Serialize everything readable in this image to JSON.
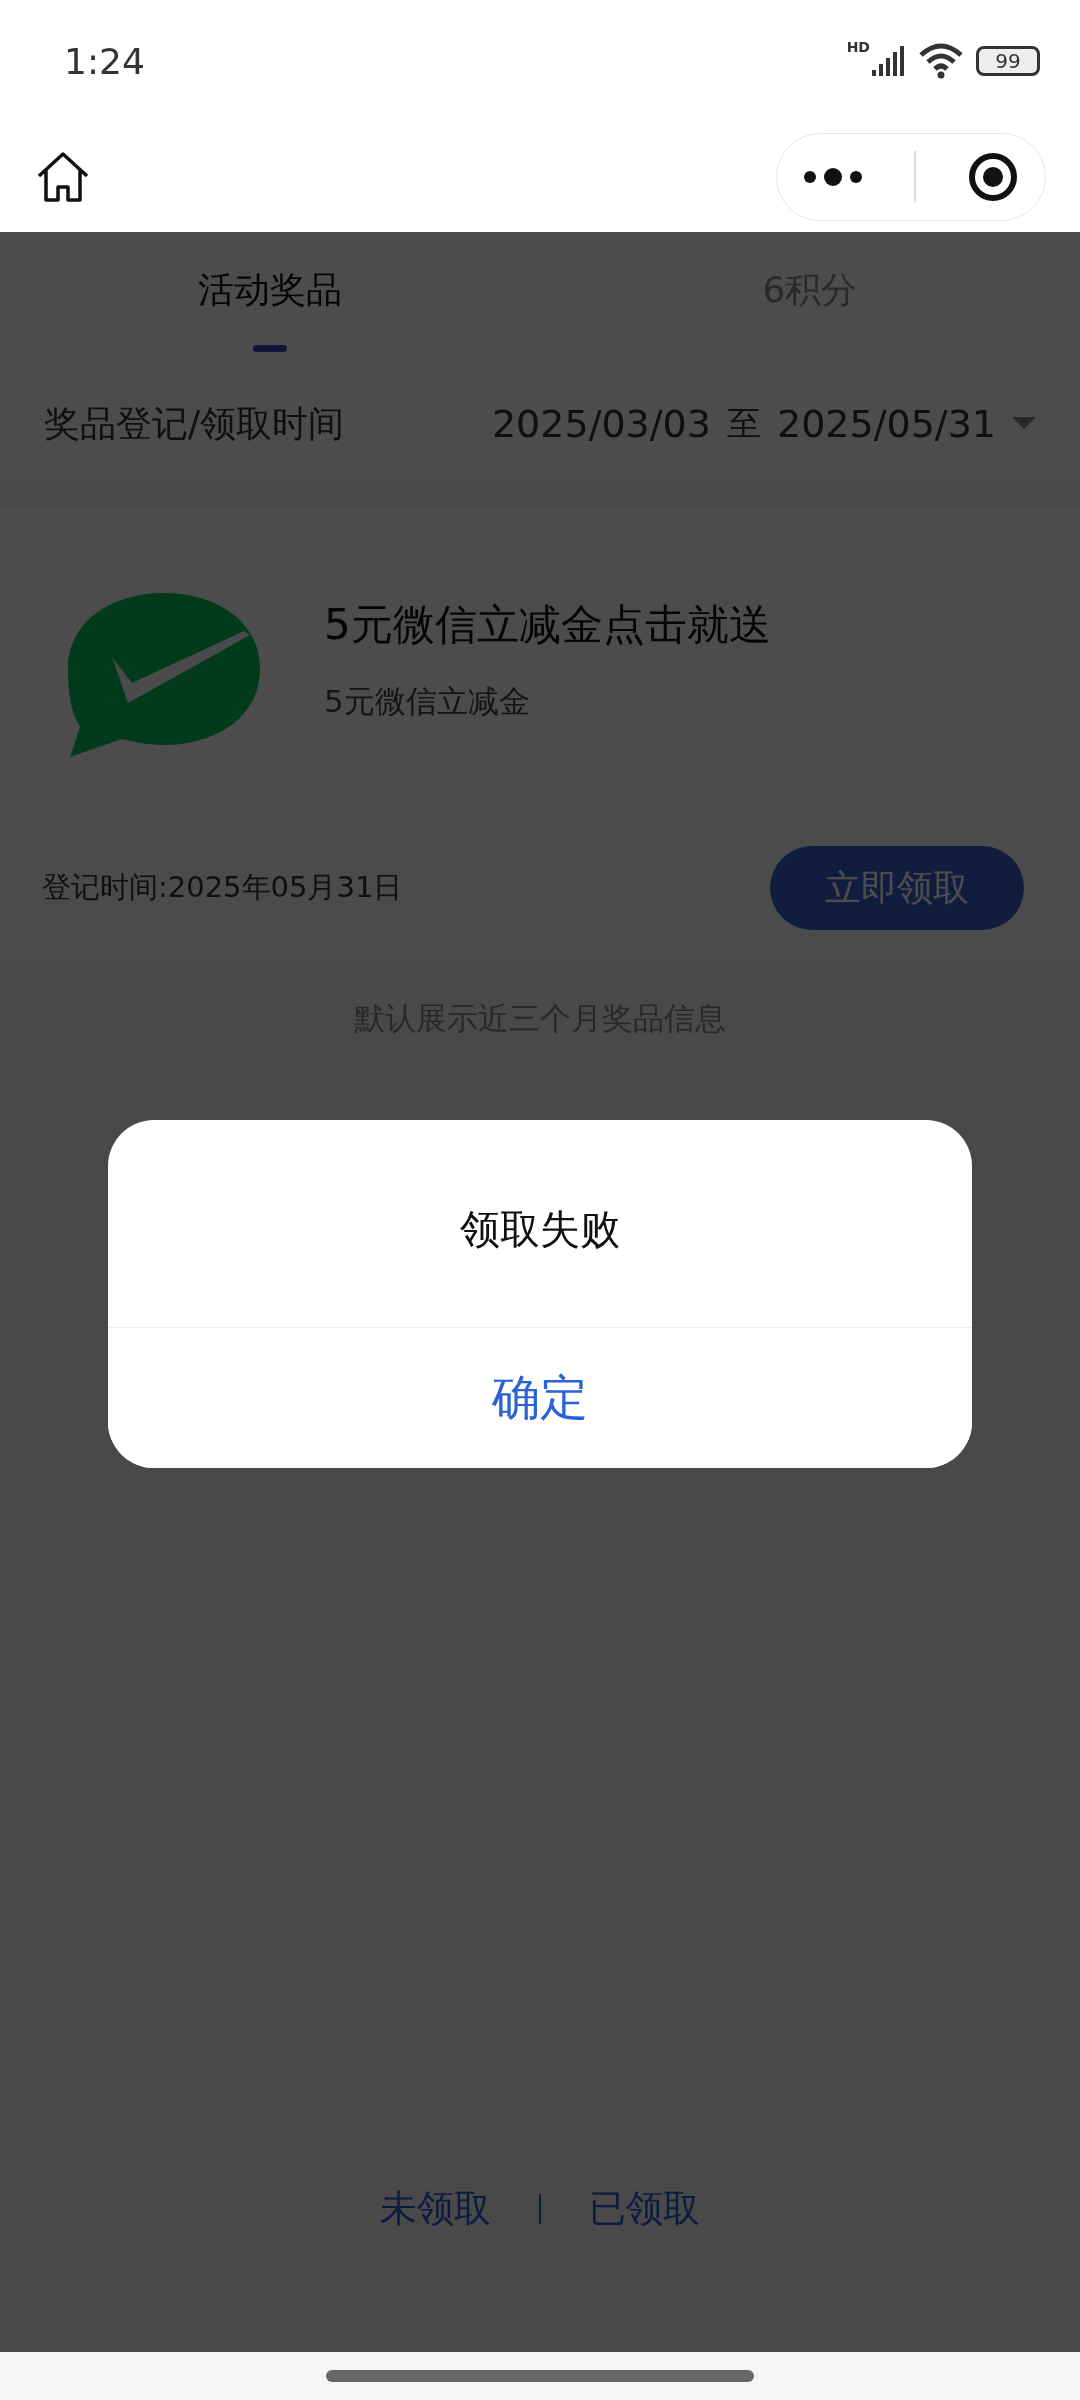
{
  "status_bar": {
    "time": "1:24",
    "network_label": "HD",
    "battery": "99"
  },
  "tabs": [
    {
      "label": "活动奖品",
      "selected": true
    },
    {
      "label": "6积分",
      "selected": false
    }
  ],
  "date_filter": {
    "label": "奖品登记/领取时间",
    "start": "2025/03/03",
    "separator": "至",
    "end": "2025/05/31"
  },
  "prizes": [
    {
      "title": "5元微信立减金点击就送",
      "subtitle": "5元微信立减金",
      "register_time": "登记时间:2025年05月31日",
      "action": "立即领取"
    }
  ],
  "note": "默认展示近三个月奖品信息",
  "bottom_links": [
    {
      "label": "未领取"
    },
    {
      "label": "已领取"
    }
  ],
  "dialog": {
    "message": "领取失败",
    "button": "确定"
  }
}
